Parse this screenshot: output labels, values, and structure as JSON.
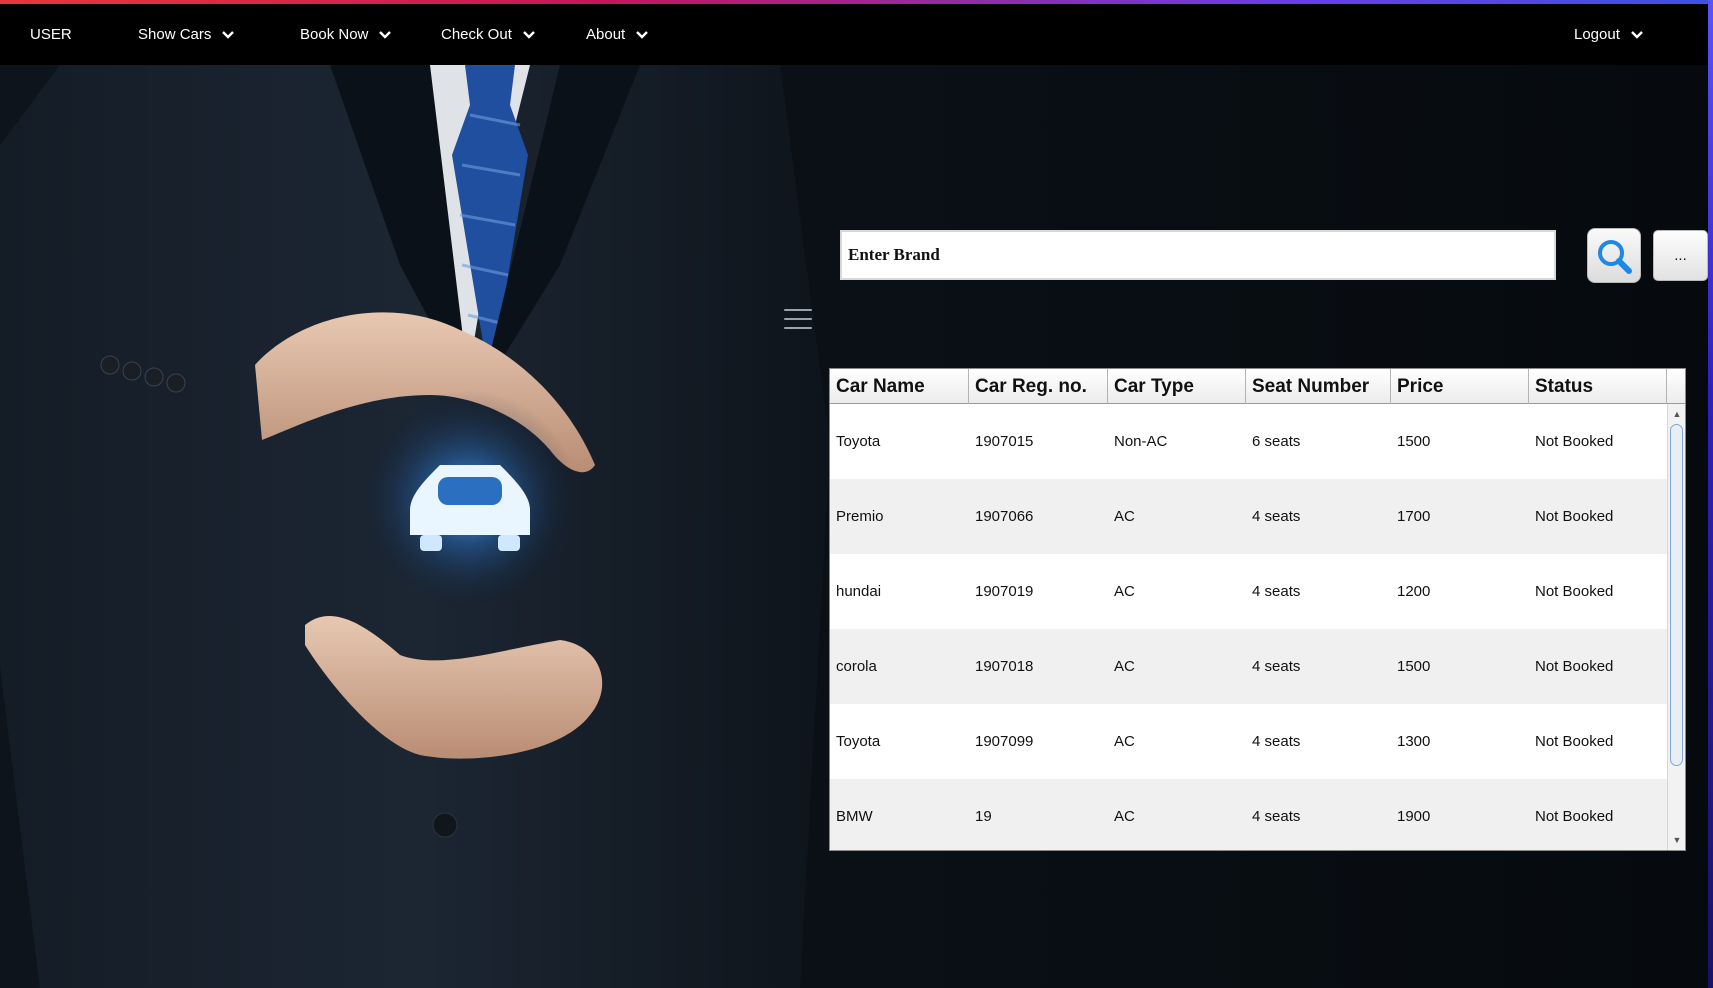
{
  "nav": {
    "user": "USER",
    "show_cars": "Show Cars",
    "book_now": "Book Now",
    "check_out": "Check Out",
    "about": "About",
    "logout": "Logout"
  },
  "search": {
    "value": "Enter Brand",
    "more_label": "..."
  },
  "table": {
    "columns": [
      "Car Name",
      "Car Reg. no.",
      "Car Type",
      "Seat Number",
      "Price",
      "Status"
    ],
    "rows": [
      [
        "Toyota",
        "1907015",
        "Non-AC",
        "6 seats",
        "1500",
        "Not Booked"
      ],
      [
        "Premio",
        "1907066",
        "AC",
        "4 seats",
        "1700",
        "Not Booked"
      ],
      [
        "hundai",
        "1907019",
        "AC",
        "4 seats",
        "1200",
        "Not Booked"
      ],
      [
        "corola",
        "1907018",
        "AC",
        "4 seats",
        "1500",
        "Not Booked"
      ],
      [
        "Toyota",
        "1907099",
        "AC",
        "4 seats",
        "1300",
        "Not Booked"
      ],
      [
        "BMW",
        "19",
        "AC",
        "4 seats",
        "1900",
        "Not Booked"
      ]
    ]
  },
  "colors": {
    "nav_bg": "#000000",
    "accent_gradient_start": "#e5383b",
    "accent_gradient_end": "#3f51e5",
    "search_icon": "#1e88e5",
    "background": "#070b10"
  }
}
